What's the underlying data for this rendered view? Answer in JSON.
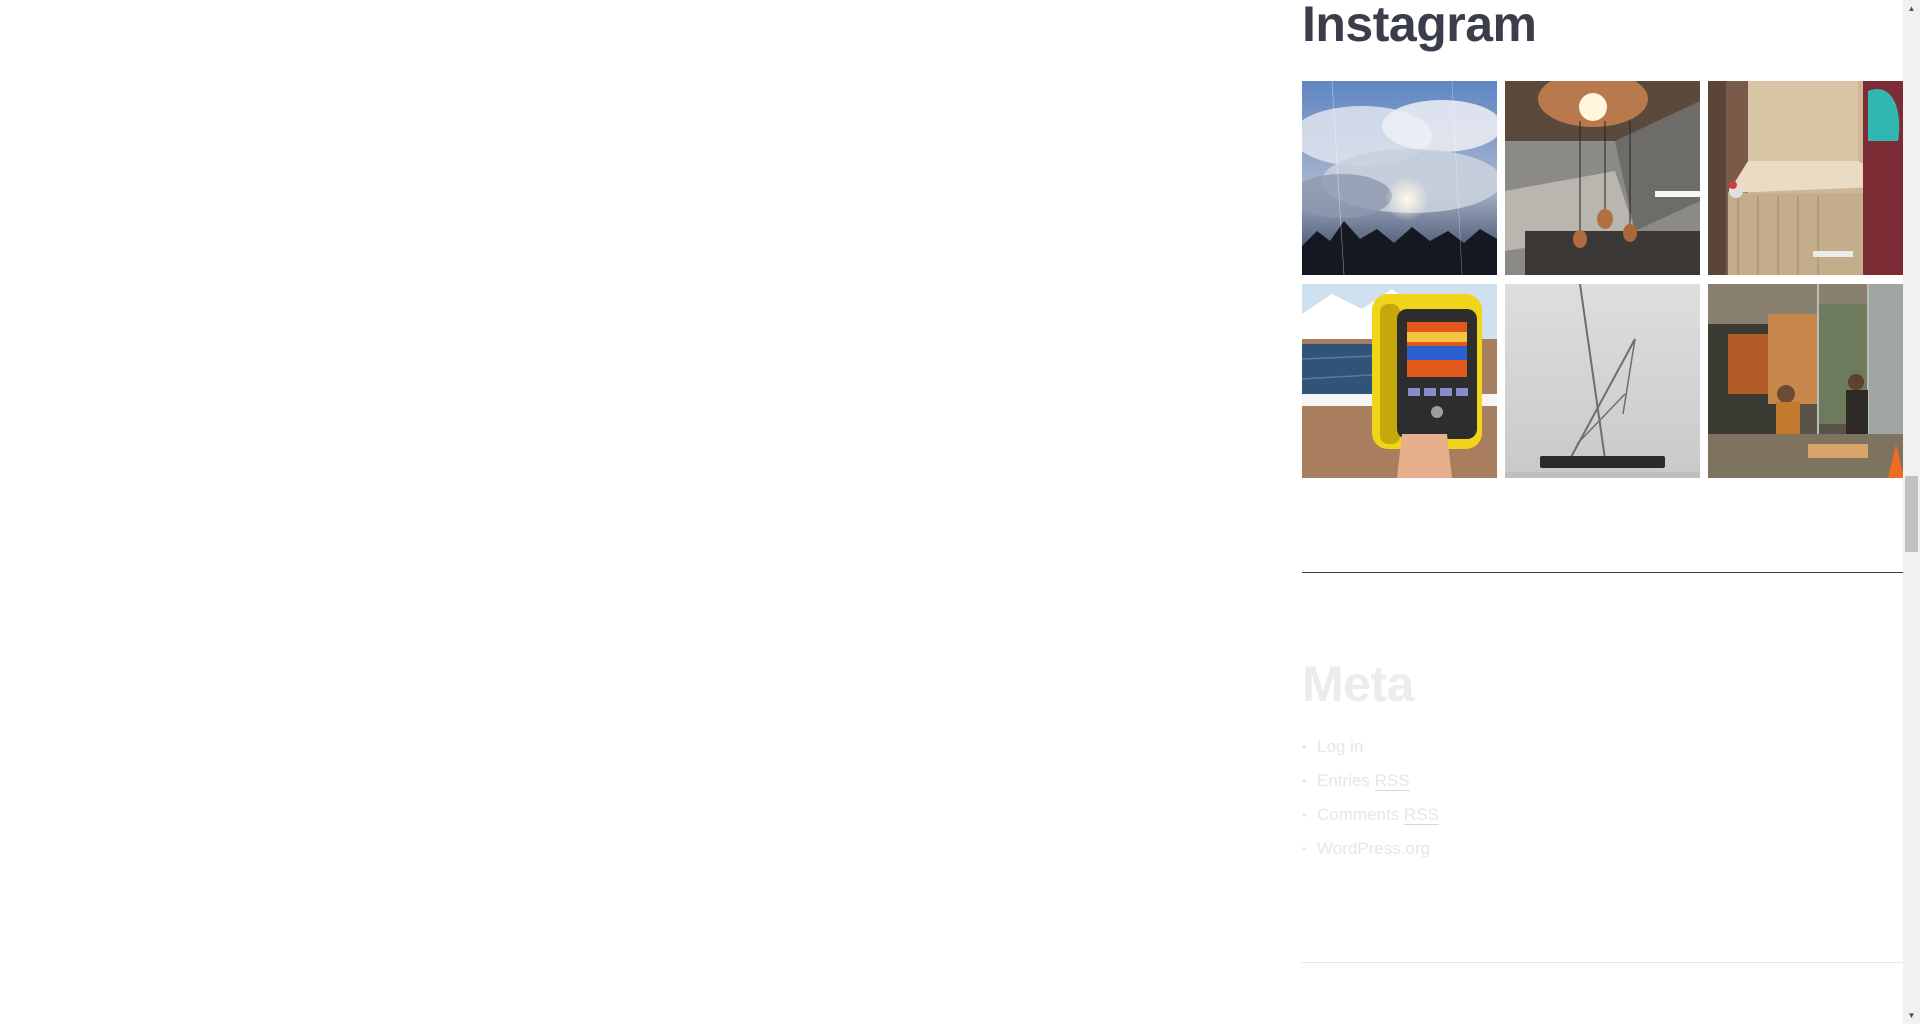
{
  "instagram": {
    "title": "Instagram",
    "images": [
      {
        "subject": "cloudy sky over trees"
      },
      {
        "subject": "copper pendant lamps"
      },
      {
        "subject": "room with window and radiator"
      },
      {
        "subject": "thermal imaging camera on roof"
      },
      {
        "subject": "metal wire sculpture"
      },
      {
        "subject": "workshop with workers"
      }
    ]
  },
  "meta": {
    "title": "Meta",
    "links": [
      {
        "label": "Log in"
      },
      {
        "label_prefix": "Entries ",
        "label_abbr": "RSS"
      },
      {
        "label_prefix": "Comments ",
        "label_abbr": "RSS"
      },
      {
        "label": "WordPress.org"
      }
    ],
    "bullet": "•"
  },
  "scrollbar": {
    "up_arrow": "▲",
    "down_arrow": "▼"
  },
  "colors": {
    "heading": "#3b3e4a",
    "faded_heading": "#ececef",
    "faded_link": "#e6e6ea"
  }
}
